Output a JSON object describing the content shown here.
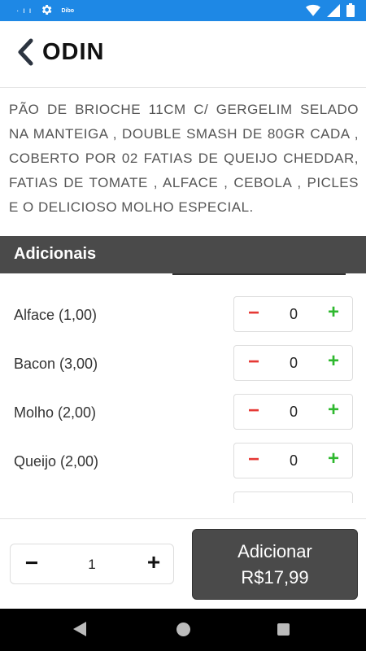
{
  "status_bar": {
    "left_dots": "· ı ı",
    "small_label": "Dibo",
    "icons": [
      "gear-icon",
      "wifi-icon",
      "signal-icon",
      "battery-icon"
    ],
    "background": "#1e88e5"
  },
  "header": {
    "title": "ODIN",
    "back_icon": "chevron-left-icon"
  },
  "description": "PÃO DE BRIOCHE 11CM C/ GERGELIM SELADO NA MANTEIGA , DOUBLE SMASH DE 80GR CADA , COBERTO POR 02 FATIAS DE QUEIJO CHEDDAR, FATIAS DE TOMATE , ALFACE , CEBOLA , PICLES E O DELICIOSO MOLHO ESPECIAL.",
  "addons": {
    "title": "Adicionais",
    "items": [
      {
        "name": "Alface (1,00)",
        "qty": "0",
        "minus": "−",
        "plus": "+"
      },
      {
        "name": "Bacon (3,00)",
        "qty": "0",
        "minus": "−",
        "plus": "+"
      },
      {
        "name": "Molho (2,00)",
        "qty": "0",
        "minus": "−",
        "plus": "+"
      },
      {
        "name": "Queijo (2,00)",
        "qty": "0",
        "minus": "−",
        "plus": "+"
      }
    ]
  },
  "footer": {
    "quantity": "1",
    "minus": "−",
    "plus": "+",
    "add_button": {
      "label": "Adicionar",
      "price": "R$17,99"
    }
  },
  "colors": {
    "accent_dark": "#4a4a4a",
    "minus_red": "#e53935",
    "plus_green": "#2eb82e"
  }
}
